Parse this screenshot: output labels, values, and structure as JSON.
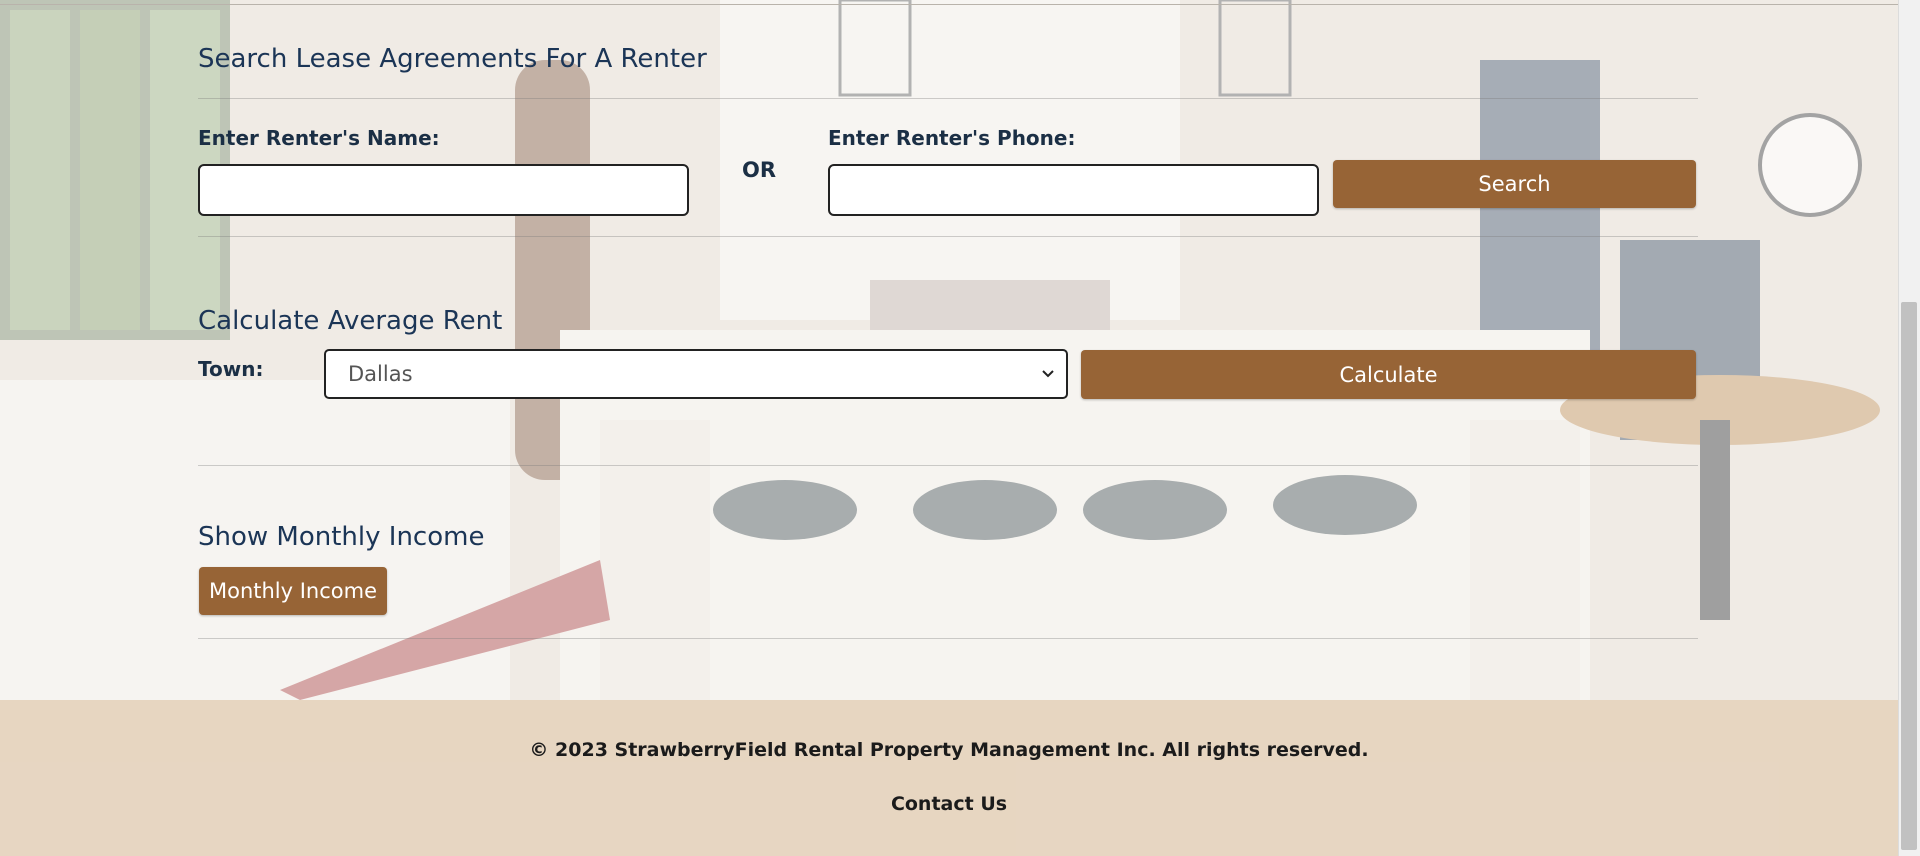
{
  "search": {
    "title": "Search Lease Agreements For A Renter",
    "name_label": "Enter Renter's Name:",
    "name_value": "",
    "or_label": "OR",
    "phone_label": "Enter Renter's Phone:",
    "phone_value": "",
    "search_button": "Search"
  },
  "average": {
    "title": "Calculate Average Rent",
    "town_label": "Town:",
    "town_selected": "Dallas",
    "calculate_button": "Calculate"
  },
  "income": {
    "title": "Show Monthly Income",
    "button": "Monthly Income"
  },
  "footer": {
    "copyright": "© 2023 StrawberryField Rental Property Management Inc. All rights reserved.",
    "contact": "Contact Us"
  },
  "colors": {
    "accent": "#976436",
    "heading": "#1b3556"
  },
  "icons": {
    "select_caret": "chevron-down-icon"
  }
}
